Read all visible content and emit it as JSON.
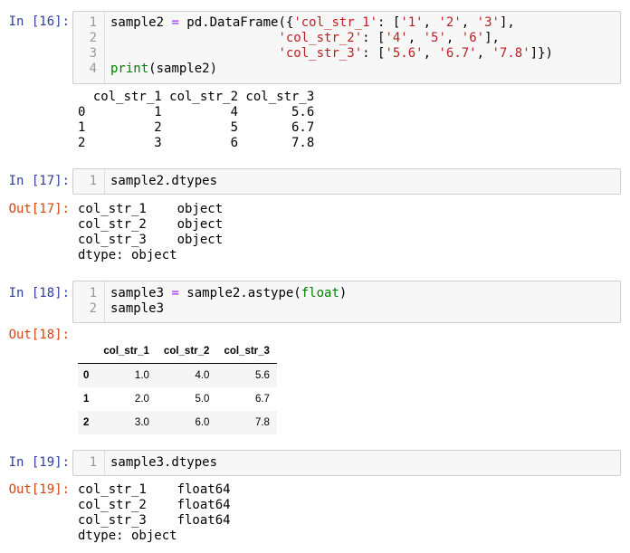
{
  "cells": {
    "c16": {
      "prompt": "In [16]:",
      "line_numbers": [
        "1",
        "2",
        "3",
        "4"
      ],
      "lines": [
        [
          [
            "",
            "sample2 "
          ],
          [
            "op",
            "="
          ],
          [
            "",
            " pd.DataFrame({"
          ],
          [
            "str",
            "'col_str_1'"
          ],
          [
            "",
            ": ["
          ],
          [
            "str",
            "'1'"
          ],
          [
            "",
            ", "
          ],
          [
            "str",
            "'2'"
          ],
          [
            "",
            ", "
          ],
          [
            "str",
            "'3'"
          ],
          [
            "",
            "],"
          ]
        ],
        [
          [
            "",
            "                      "
          ],
          [
            "str",
            "'col_str_2'"
          ],
          [
            "",
            ": ["
          ],
          [
            "str",
            "'4'"
          ],
          [
            "",
            ", "
          ],
          [
            "str",
            "'5'"
          ],
          [
            "",
            ", "
          ],
          [
            "str",
            "'6'"
          ],
          [
            "",
            "],"
          ]
        ],
        [
          [
            "",
            "                      "
          ],
          [
            "str",
            "'col_str_3'"
          ],
          [
            "",
            ": ["
          ],
          [
            "str",
            "'5.6'"
          ],
          [
            "",
            ", "
          ],
          [
            "str",
            "'6.7'"
          ],
          [
            "",
            ", "
          ],
          [
            "str",
            "'7.8'"
          ],
          [
            "",
            "]})"
          ]
        ],
        [
          [
            "builtin",
            "print"
          ],
          [
            "",
            "(sample2)"
          ]
        ]
      ],
      "output": "  col_str_1 col_str_2 col_str_3\n0         1         4       5.6\n1         2         5       6.7\n2         3         6       7.8"
    },
    "c17": {
      "prompt": "In [17]:",
      "line_numbers": [
        "1"
      ],
      "lines": [
        [
          [
            "",
            "sample2.dtypes"
          ]
        ]
      ],
      "out_prompt": "Out[17]:",
      "output": "col_str_1    object\ncol_str_2    object\ncol_str_3    object\ndtype: object"
    },
    "c18": {
      "prompt": "In [18]:",
      "line_numbers": [
        "1",
        "2"
      ],
      "lines": [
        [
          [
            "",
            "sample3 "
          ],
          [
            "op",
            "="
          ],
          [
            "",
            " sample2.astype("
          ],
          [
            "builtin",
            "float"
          ],
          [
            "",
            ")"
          ]
        ],
        [
          [
            "",
            "sample3"
          ]
        ]
      ],
      "out_prompt": "Out[18]:",
      "table": {
        "columns": [
          "",
          "col_str_1",
          "col_str_2",
          "col_str_3"
        ],
        "rows": [
          [
            "0",
            "1.0",
            "4.0",
            "5.6"
          ],
          [
            "1",
            "2.0",
            "5.0",
            "6.7"
          ],
          [
            "2",
            "3.0",
            "6.0",
            "7.8"
          ]
        ]
      }
    },
    "c19": {
      "prompt": "In [19]:",
      "line_numbers": [
        "1"
      ],
      "lines": [
        [
          [
            "",
            "sample3.dtypes"
          ]
        ]
      ],
      "out_prompt": "Out[19]:",
      "output": "col_str_1    float64\ncol_str_2    float64\ncol_str_3    float64\ndtype: object"
    }
  }
}
